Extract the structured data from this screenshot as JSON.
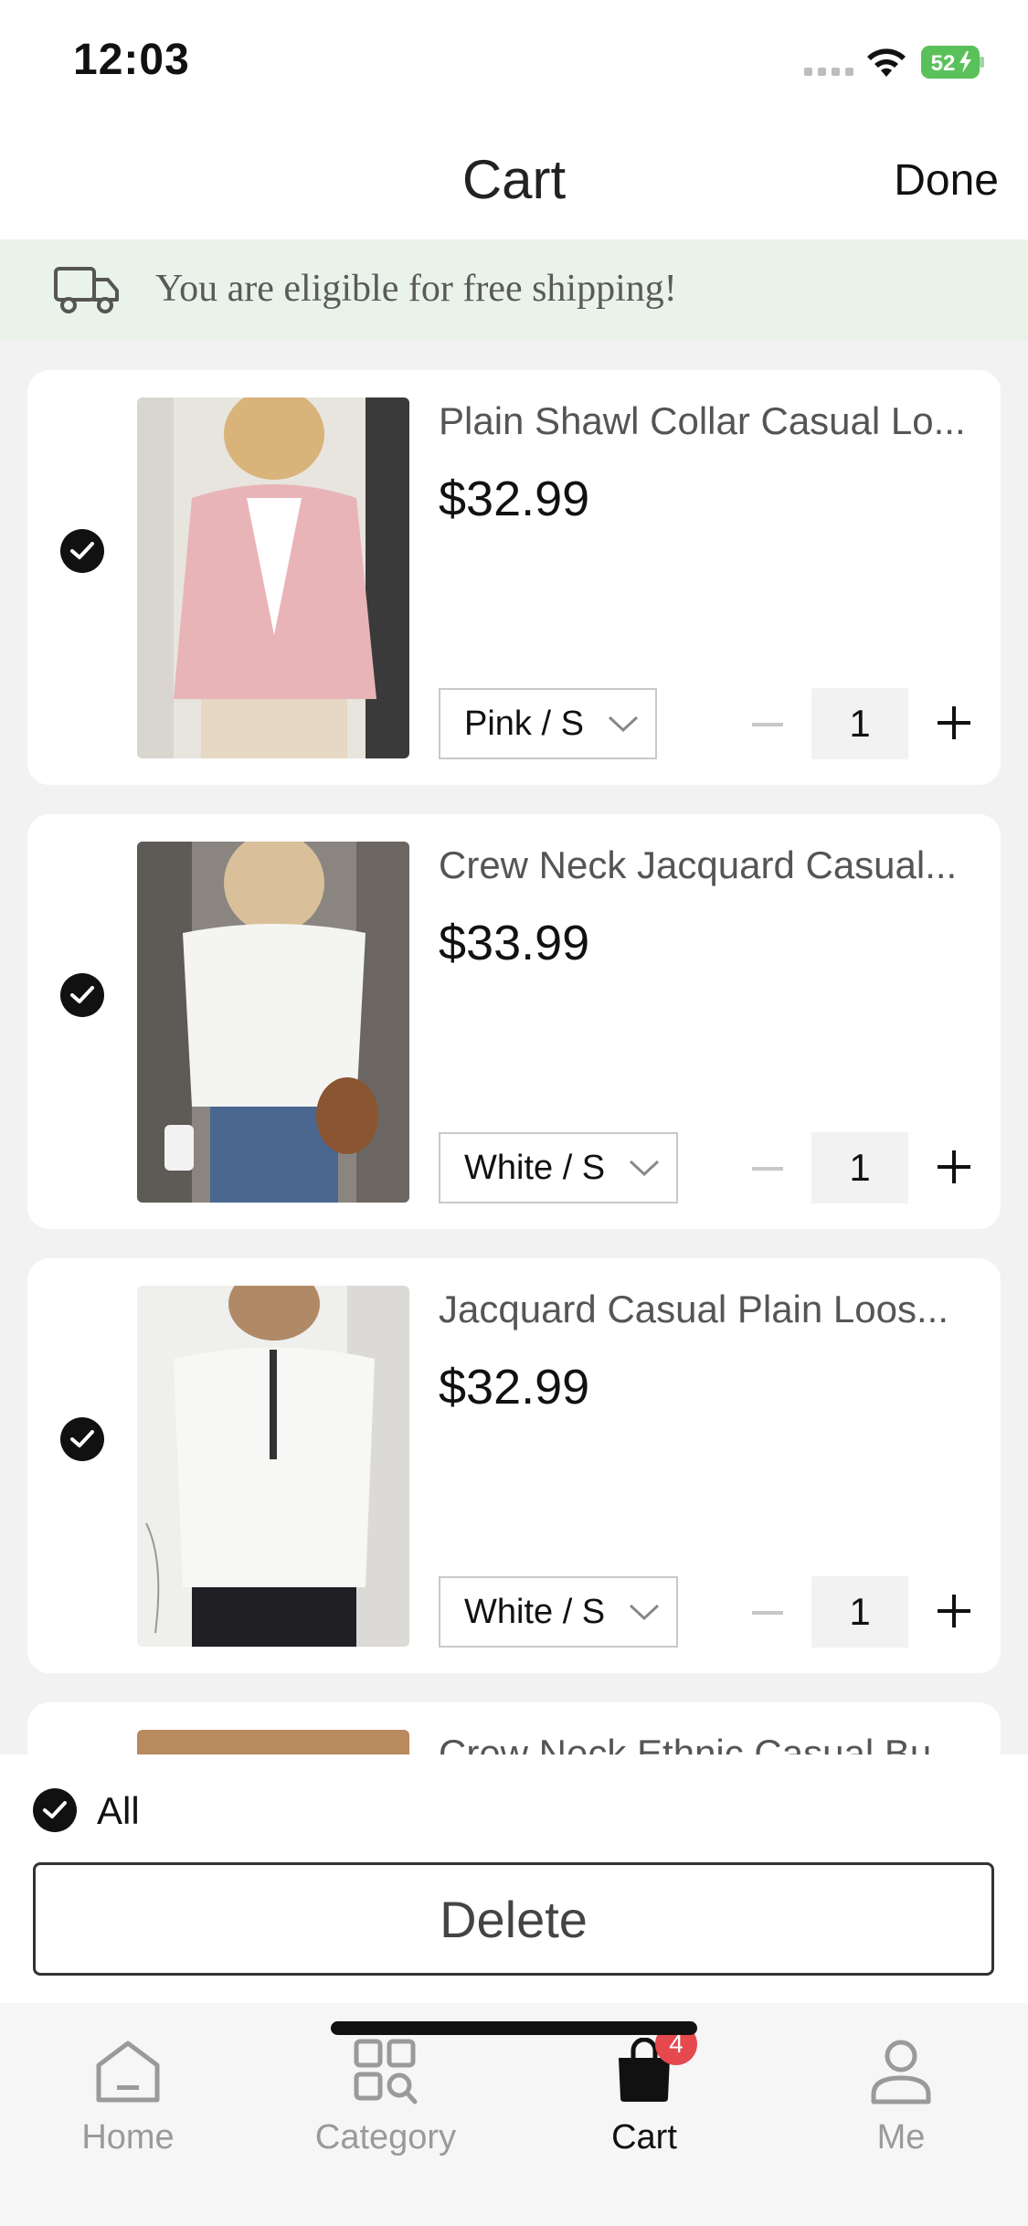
{
  "status_bar": {
    "time": "12:03",
    "battery": "52"
  },
  "nav": {
    "title": "Cart",
    "done_label": "Done"
  },
  "banner": {
    "text": "You are eligible for free shipping!",
    "icon": "truck-icon"
  },
  "cart_items": [
    {
      "name": "Plain Shawl Collar Casual Lo...",
      "price": "$32.99",
      "variant": "Pink / S",
      "quantity": "1",
      "selected": true
    },
    {
      "name": "Crew Neck Jacquard Casual...",
      "price": "$33.99",
      "variant": "White / S",
      "quantity": "1",
      "selected": true
    },
    {
      "name": "Jacquard Casual Plain Loos...",
      "price": "$32.99",
      "variant": "White / S",
      "quantity": "1",
      "selected": true
    },
    {
      "name": "Crew Neck Ethnic Casual Bu...",
      "price": "",
      "variant": "",
      "quantity": "",
      "selected": true
    }
  ],
  "actions": {
    "all_label": "All",
    "delete_label": "Delete"
  },
  "tab_bar": {
    "tabs": [
      {
        "label": "Home",
        "icon": "home-icon",
        "active": false
      },
      {
        "label": "Category",
        "icon": "category-icon",
        "active": false
      },
      {
        "label": "Cart",
        "icon": "cart-bag-icon",
        "active": true,
        "badge": "4"
      },
      {
        "label": "Me",
        "icon": "profile-icon",
        "active": false
      }
    ]
  },
  "colors": {
    "accent": "#111111",
    "badge": "#e5484d",
    "banner_bg": "#eaf3ea",
    "battery_green": "#5ac15a"
  }
}
